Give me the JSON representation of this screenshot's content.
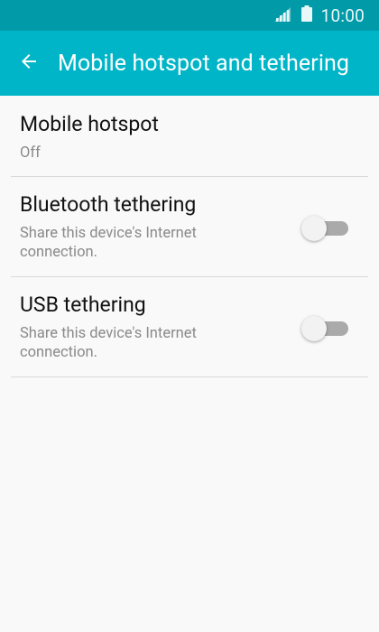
{
  "status_bar": {
    "time": "10:00",
    "signal_icon": "signal-icon",
    "battery_icon": "battery-icon"
  },
  "app_bar": {
    "title": "Mobile hotspot and tethering",
    "back_icon": "back-arrow-icon",
    "color": "#00b5c7"
  },
  "items": [
    {
      "title": "Mobile hotspot",
      "subtitle": "Off"
    },
    {
      "title": "Bluetooth tethering",
      "subtitle": "Share this device's Internet connection.",
      "enabled": false
    },
    {
      "title": "USB tethering",
      "subtitle": "Share this device's Internet connection.",
      "enabled": false
    }
  ]
}
